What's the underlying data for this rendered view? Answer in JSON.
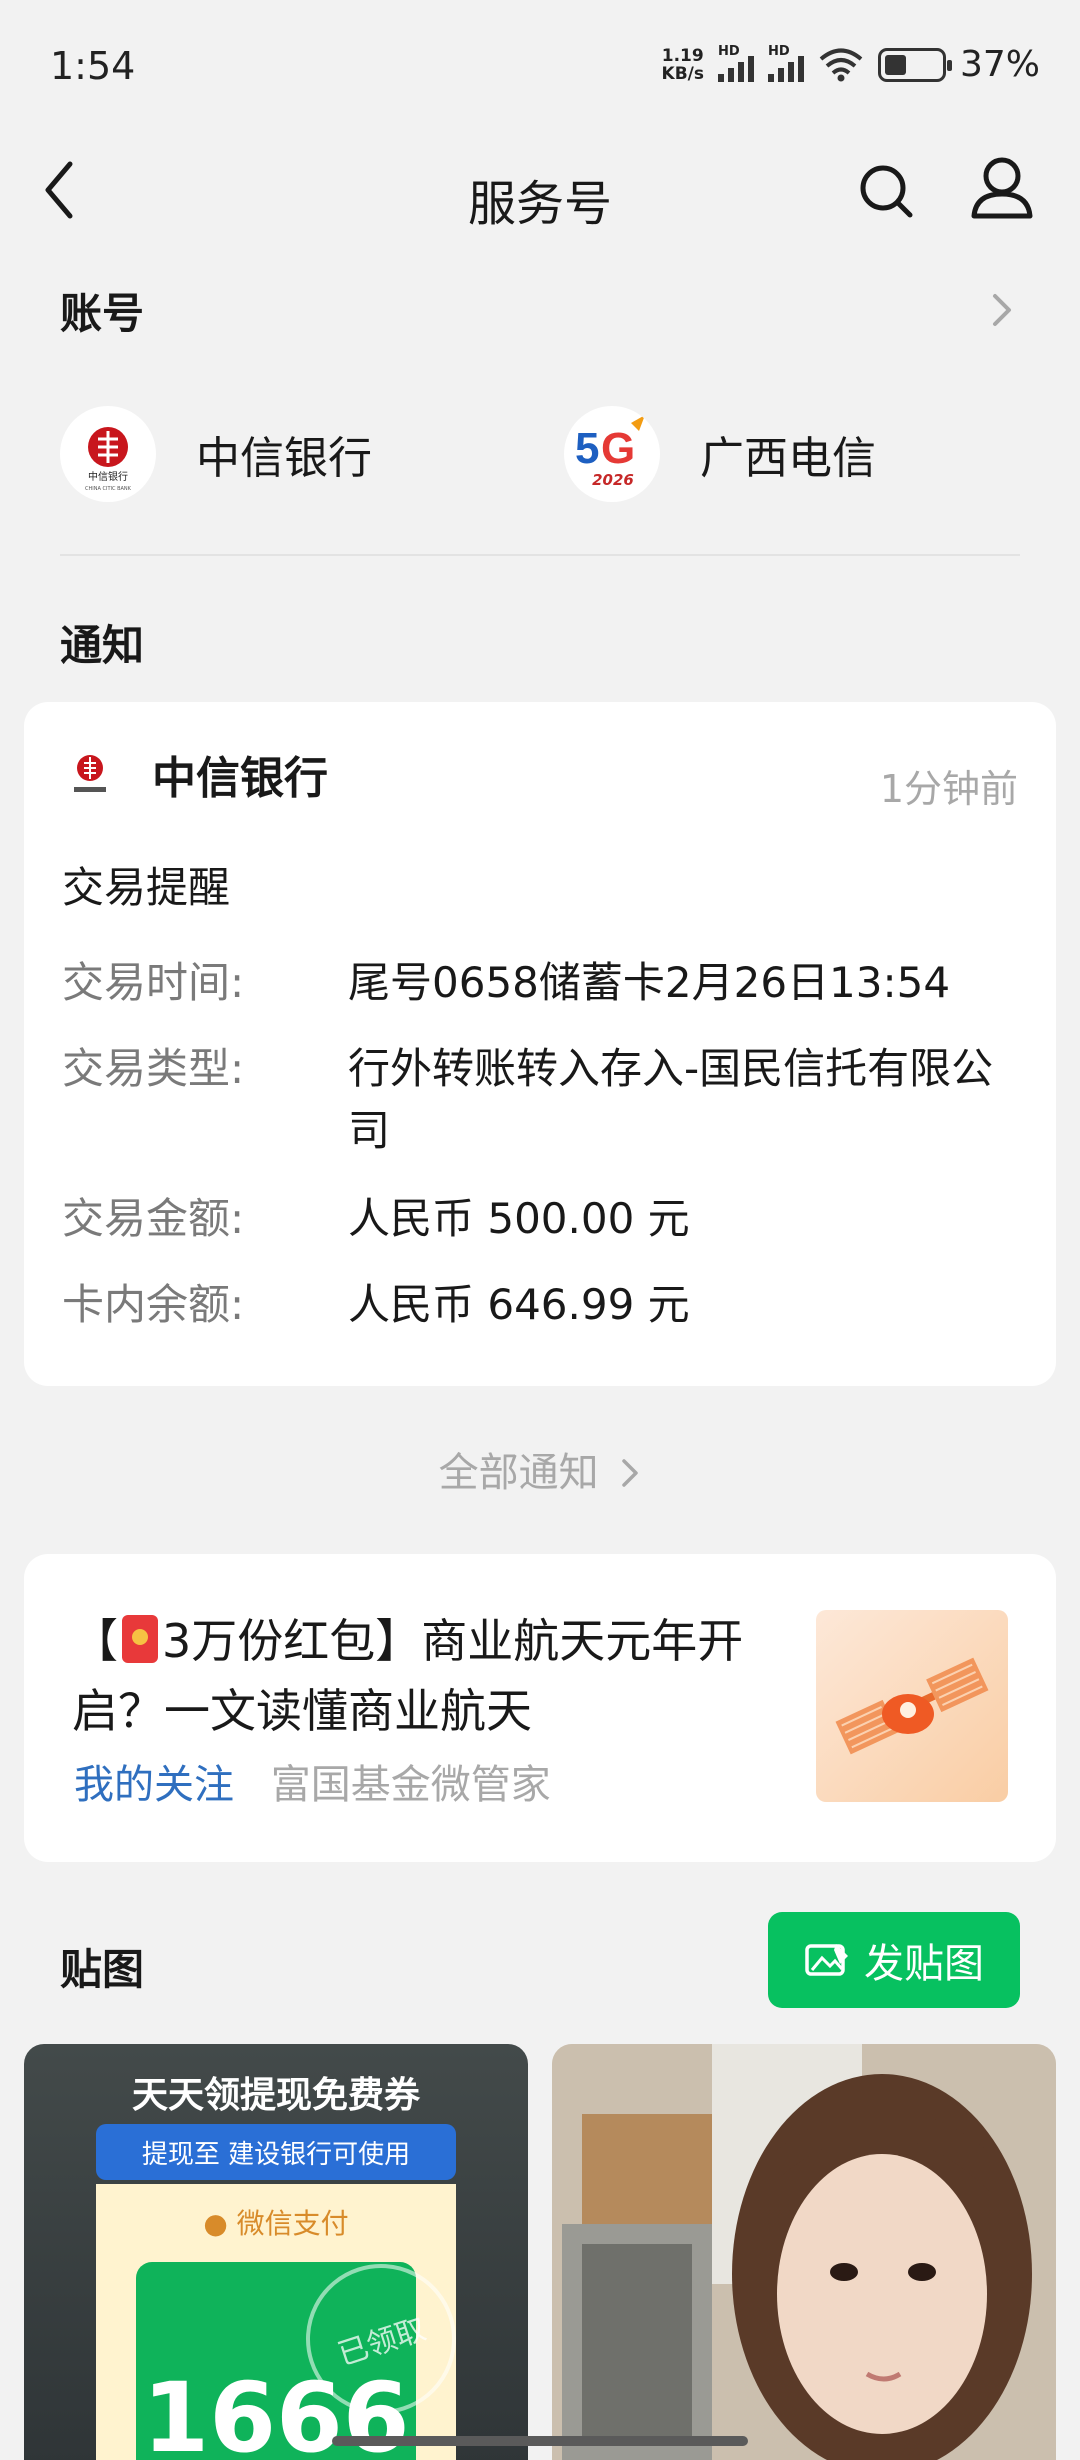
{
  "status_bar": {
    "time": "1:54",
    "net_speed_value": "1.19",
    "net_speed_unit": "KB/s",
    "signal_tag": "HD",
    "battery": "37%",
    "battery_level": 0.37
  },
  "header": {
    "title": "服务号"
  },
  "accounts": {
    "title": "账号",
    "items": [
      {
        "name": "中信银行",
        "icon": "citic-bank-logo",
        "logo_caption": "中信银行",
        "logo_caption_en": "CHINA CITIC BANK"
      },
      {
        "name": "广西电信",
        "icon": "telecom-5g-logo",
        "logo_caption": "2026"
      }
    ]
  },
  "notifications": {
    "title": "通知",
    "card": {
      "sender": "中信银行",
      "time": "1分钟前",
      "subject": "交易提醒",
      "rows": [
        {
          "key": "交易时间:",
          "value": "尾号0658储蓄卡2月26日13:54"
        },
        {
          "key": "交易类型:",
          "value": "行外转账转入存入-国民信托有限公司"
        },
        {
          "key": "交易金额:",
          "value": "人民币 500.00 元"
        },
        {
          "key": "卡内余额:",
          "value": "人民币 646.99 元"
        }
      ]
    },
    "all_link": "全部通知"
  },
  "article": {
    "title_prefix": "【",
    "title_rest": "3万份红包】商业航天元年开启？一文读懂商业航天",
    "tag": "我的关注",
    "source": "富国基金微管家"
  },
  "stickers": {
    "title": "贴图",
    "post_button": "发贴图",
    "items": [
      {
        "headline": "天天领提现免费券",
        "banner": "提现至 建设银行可使用",
        "pay_label": "微信支付",
        "amount": "1666",
        "stamp": "已领取"
      },
      {
        "kind": "photo"
      }
    ]
  },
  "colors": {
    "accent_green": "#07c160",
    "link_blue": "#2f6fbf",
    "muted": "#a8a8a8"
  }
}
